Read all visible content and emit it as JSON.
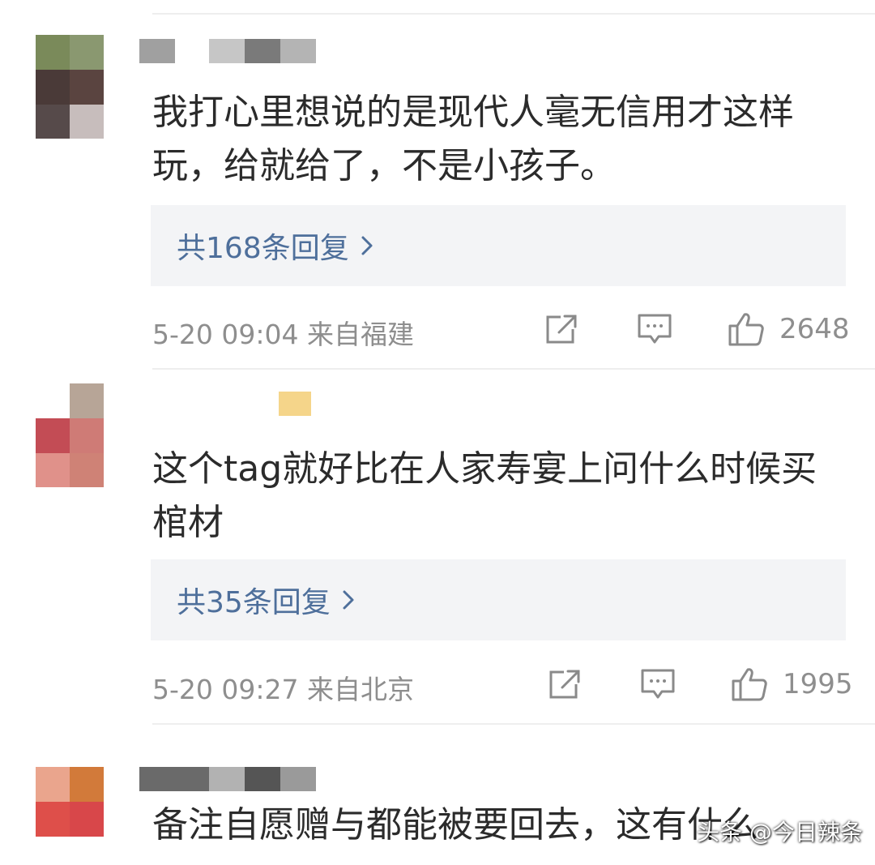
{
  "comments": [
    {
      "text": "我打心里想说的是现代人毫无信用才这样玩，给就给了，不是小孩子。",
      "replies_label": "共168条回复",
      "time_location": "5-20 09:04  来自福建",
      "likes": "2648"
    },
    {
      "text": "这个tag就好比在人家寿宴上问什么时候买棺材",
      "replies_label": "共35条回复",
      "time_location": "5-20 09:27  来自北京",
      "likes": "1995"
    },
    {
      "text": "备注自愿赠与都能被要回去，这有什么"
    }
  ],
  "watermark": "头条 @今日辣条",
  "icons": {
    "share": "share-icon",
    "comment": "comment-icon",
    "like": "thumbs-up-icon",
    "chevron": "chevron-right-icon"
  },
  "colors": {
    "link": "#4e6f9b",
    "meta": "#8e8e8e",
    "text": "#2b2b2b",
    "reply_bg": "#f3f4f6"
  }
}
